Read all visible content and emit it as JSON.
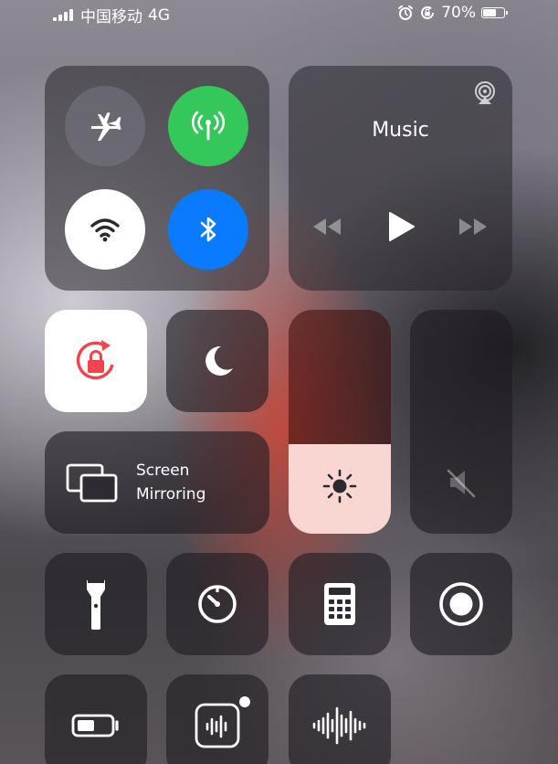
{
  "status_bar": {
    "carrier": "中国移动",
    "network": "4G",
    "battery_text": "70%",
    "battery_level": 0.7
  },
  "connectivity": {
    "airplane_on": false,
    "cellular_on": true,
    "wifi_on": true,
    "bluetooth_on": true
  },
  "music": {
    "title": "Music"
  },
  "screen_mirroring": {
    "line1": "Screen",
    "line2": "Mirroring"
  },
  "sliders": {
    "brightness_level": 0.4,
    "volume_level": 0.0
  },
  "icons": [
    "airplane-icon",
    "cellular-icon",
    "wifi-icon",
    "bluetooth-icon",
    "airplay-icon",
    "rewind-icon",
    "play-icon",
    "fast-forward-icon",
    "orientation-lock-icon",
    "moon-icon",
    "screen-mirroring-icon",
    "brightness-icon",
    "mute-icon",
    "flashlight-icon",
    "timer-icon",
    "calculator-icon",
    "screen-record-icon",
    "low-power-icon",
    "voice-memos-icon",
    "sound-recognition-icon",
    "alarm-icon",
    "rotation-lock-status-icon"
  ],
  "colors": {
    "cellular_green": "#34C759",
    "bluetooth_blue": "#0A7AFF",
    "orientation_red": "#F0454A",
    "brightness_fill": "#FFDED8"
  }
}
